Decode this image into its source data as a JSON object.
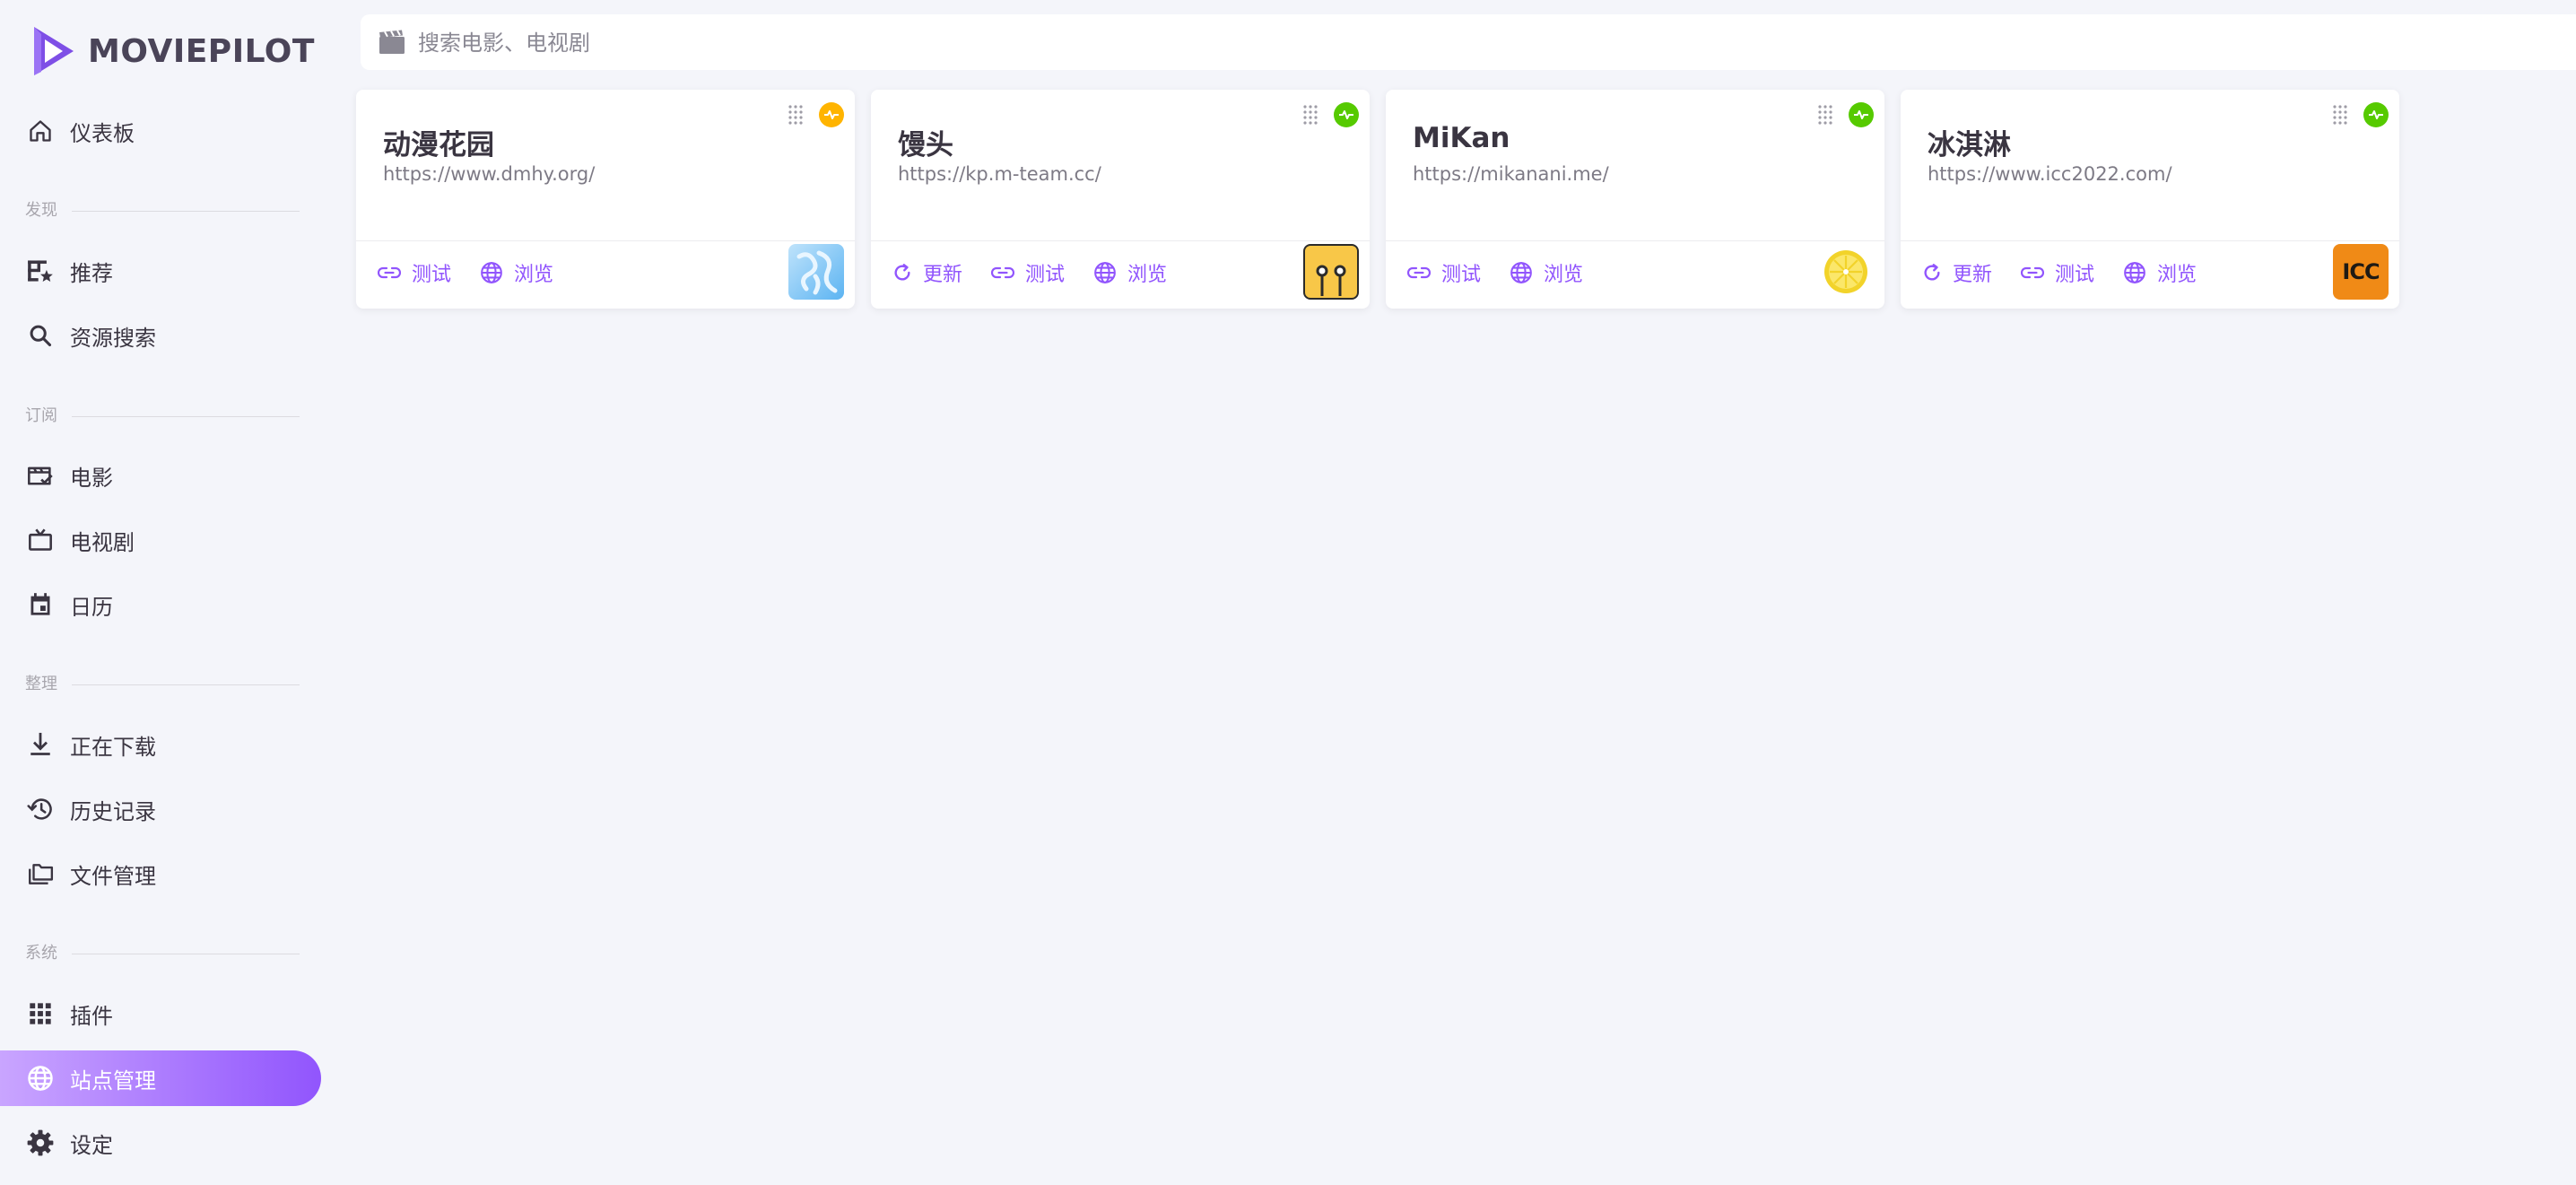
{
  "app": {
    "name": "MOVIEPILOT",
    "accent_color": "#9155FD",
    "logo_icon": "moviepilot-logo-icon"
  },
  "search": {
    "placeholder": "搜索电影、电视剧",
    "value": "",
    "icon": "clapperboard-icon"
  },
  "sidebar": {
    "top_items": [
      {
        "label": "仪表板",
        "icon": "home-icon"
      }
    ],
    "sections": [
      {
        "label": "发现",
        "items": [
          {
            "label": "推荐",
            "icon": "grid-star-icon"
          },
          {
            "label": "资源搜索",
            "icon": "search-icon"
          }
        ]
      },
      {
        "label": "订阅",
        "items": [
          {
            "label": "电影",
            "icon": "movie-check-icon"
          },
          {
            "label": "电视剧",
            "icon": "tv-icon"
          },
          {
            "label": "日历",
            "icon": "calendar-icon"
          }
        ]
      },
      {
        "label": "整理",
        "items": [
          {
            "label": "正在下载",
            "icon": "download-icon"
          },
          {
            "label": "历史记录",
            "icon": "history-icon"
          },
          {
            "label": "文件管理",
            "icon": "folders-icon"
          }
        ]
      },
      {
        "label": "系统",
        "items": [
          {
            "label": "插件",
            "icon": "apps-icon"
          },
          {
            "label": "站点管理",
            "icon": "globe-icon",
            "active": true
          },
          {
            "label": "设定",
            "icon": "gear-icon"
          }
        ]
      }
    ]
  },
  "sites": [
    {
      "name": "动漫花园",
      "url": "https://www.dmhy.org/",
      "status_color": "#FFB400",
      "logo": "dmhy-logo",
      "actions": [
        {
          "label": "测试",
          "icon": "link-icon"
        },
        {
          "label": "浏览",
          "icon": "globe-icon"
        }
      ]
    },
    {
      "name": "馒头",
      "url": "https://kp.m-team.cc/",
      "status_color": "#56CA00",
      "logo": "m-team-logo",
      "actions": [
        {
          "label": "更新",
          "icon": "refresh-icon"
        },
        {
          "label": "测试",
          "icon": "link-icon"
        },
        {
          "label": "浏览",
          "icon": "globe-icon"
        }
      ]
    },
    {
      "name": "MiKan",
      "url": "https://mikanani.me/",
      "status_color": "#56CA00",
      "logo": "mikan-logo",
      "actions": [
        {
          "label": "测试",
          "icon": "link-icon"
        },
        {
          "label": "浏览",
          "icon": "globe-icon"
        }
      ]
    },
    {
      "name": "冰淇淋",
      "url": "https://www.icc2022.com/",
      "status_color": "#56CA00",
      "logo": "icc-logo",
      "logo_text": "ICC",
      "actions": [
        {
          "label": "更新",
          "icon": "refresh-icon"
        },
        {
          "label": "测试",
          "icon": "link-icon"
        },
        {
          "label": "浏览",
          "icon": "globe-icon"
        }
      ]
    }
  ]
}
